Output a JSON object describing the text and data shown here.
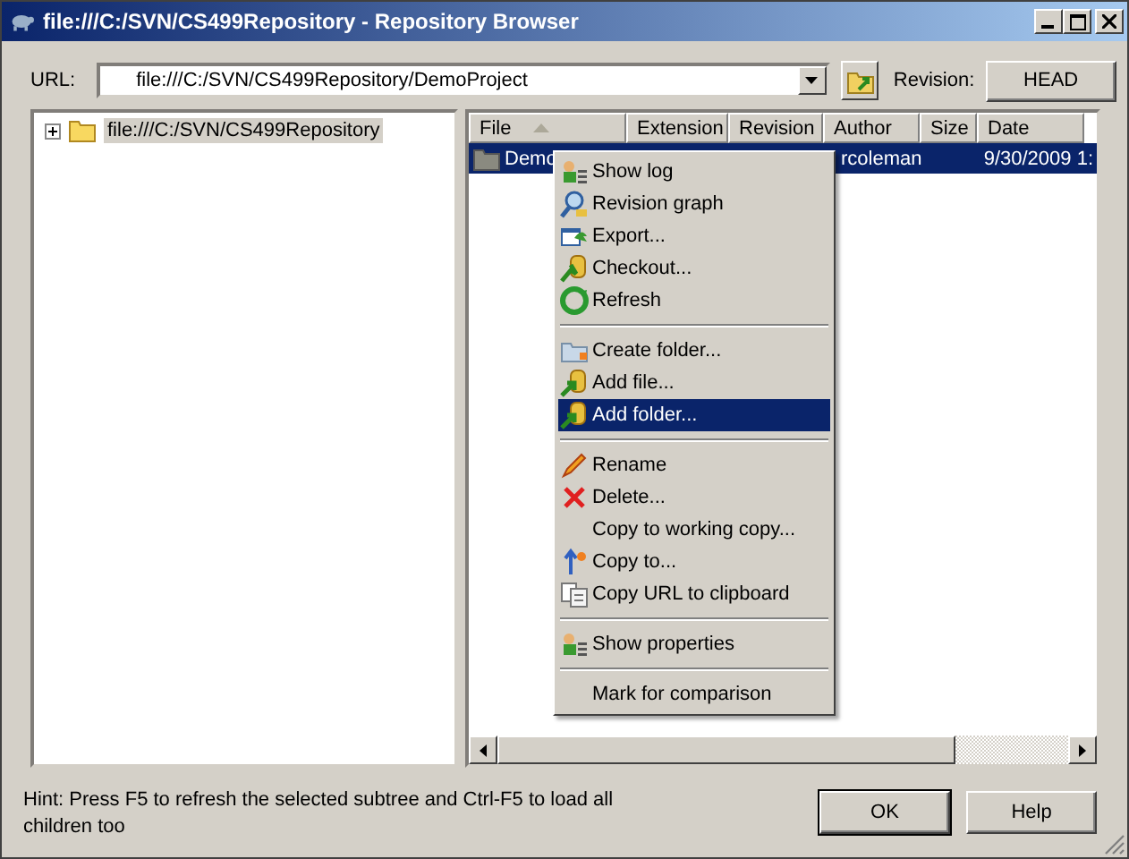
{
  "window": {
    "title": "file:///C:/SVN/CS499Repository - Repository Browser"
  },
  "url_bar": {
    "label": "URL:",
    "value": "file:///C:/SVN/CS499Repository/DemoProject",
    "revision_label": "Revision:",
    "revision_button": "HEAD"
  },
  "tree": [
    {
      "label": "file:///C:/SVN/CS499Repository",
      "expanded": false,
      "selected": true
    }
  ],
  "table": {
    "columns": [
      {
        "label": "File",
        "sorted": true
      },
      {
        "label": "Extension",
        "sorted": false
      },
      {
        "label": "Revision",
        "sorted": false
      },
      {
        "label": "Author",
        "sorted": false
      },
      {
        "label": "Size",
        "sorted": false
      },
      {
        "label": "Date",
        "sorted": false
      }
    ],
    "rows": [
      {
        "file": "Demo",
        "author": "rcoleman",
        "date": "9/30/2009 1:",
        "selected": true
      }
    ]
  },
  "context_menu": [
    [
      {
        "label": "Show log",
        "selected": false
      },
      {
        "label": "Revision graph",
        "selected": false
      },
      {
        "label": "Export...",
        "selected": false
      },
      {
        "label": "Checkout...",
        "selected": false
      },
      {
        "label": "Refresh",
        "selected": false
      }
    ],
    [
      {
        "label": "Create folder...",
        "selected": false
      },
      {
        "label": "Add file...",
        "selected": false
      },
      {
        "label": "Add folder...",
        "selected": true
      }
    ],
    [
      {
        "label": "Rename",
        "selected": false
      },
      {
        "label": "Delete...",
        "selected": false
      },
      {
        "label": "Copy to working copy...",
        "selected": false
      },
      {
        "label": "Copy to...",
        "selected": false
      },
      {
        "label": "Copy URL to clipboard",
        "selected": false
      }
    ],
    [
      {
        "label": "Show properties",
        "selected": false
      }
    ],
    [
      {
        "label": "Mark for comparison",
        "selected": false
      }
    ]
  ],
  "hint": "Hint: Press F5 to refresh the selected subtree and Ctrl-F5 to load all children too",
  "buttons": [
    "OK",
    "Help"
  ]
}
